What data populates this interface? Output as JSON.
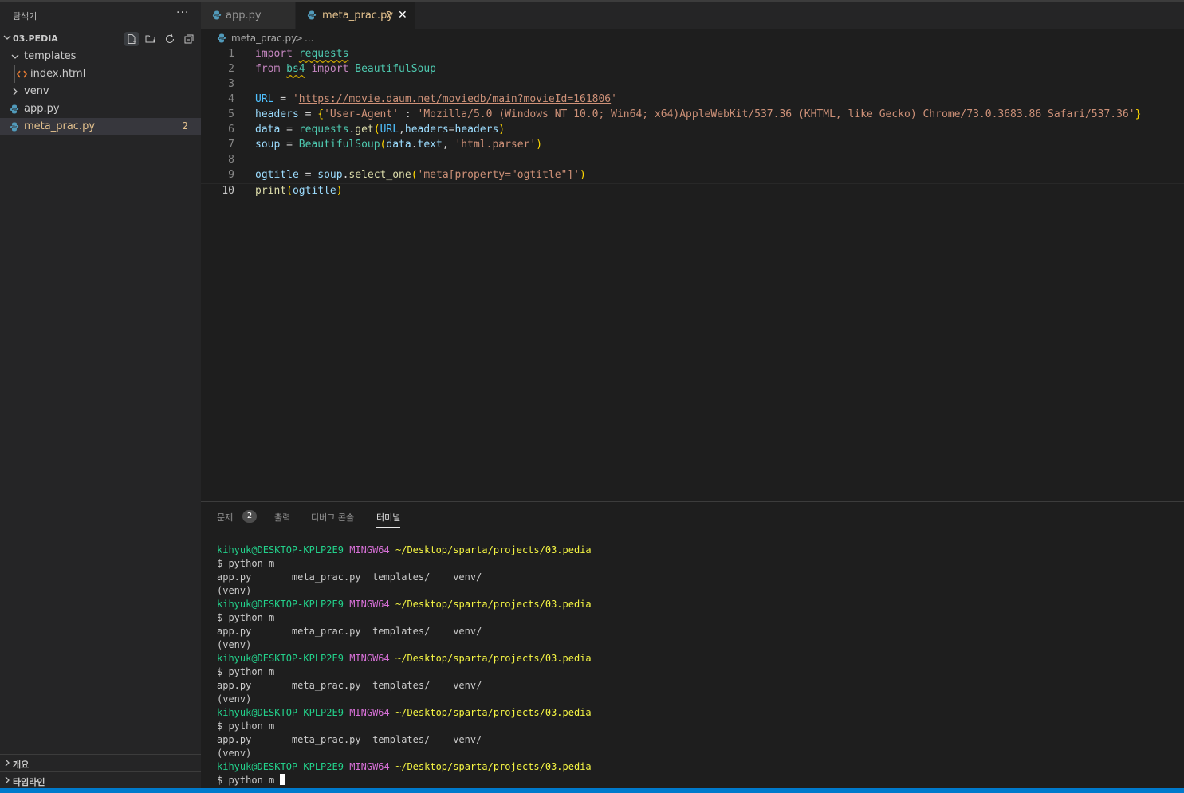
{
  "explorer": {
    "title": "탐색기",
    "more": "···",
    "folder": "03.PEDIA",
    "tree": [
      {
        "label": "templates",
        "type": "folder-open"
      },
      {
        "label": "index.html",
        "type": "html-file"
      },
      {
        "label": "venv",
        "type": "folder-closed"
      },
      {
        "label": "app.py",
        "type": "python-file"
      },
      {
        "label": "meta_prac.py",
        "type": "python-file",
        "badge": "2",
        "selected": true
      }
    ],
    "bottom_sections": [
      "개요",
      "타임라인"
    ]
  },
  "tabs": [
    {
      "label": "app.py",
      "active": false
    },
    {
      "label": "meta_prac.py",
      "count": "2",
      "active": true,
      "close": "✕"
    }
  ],
  "breadcrumb": {
    "file": "meta_prac.py",
    "sep": ">",
    "rest": "..."
  },
  "code": {
    "line_numbers": [
      "1",
      "2",
      "3",
      "4",
      "5",
      "6",
      "7",
      "8",
      "9",
      "10"
    ],
    "current_line": "10",
    "tokens": {
      "import": "import",
      "requests": "requests",
      "from": "from",
      "bs4": "bs4",
      "BeautifulSoup": "BeautifulSoup",
      "URL": "URL",
      "eq": " = ",
      "url_q": "'",
      "url_value": "https://movie.daum.net/moviedb/main?movieId=161806",
      "headers": "headers",
      "brace_open": "{",
      "brace_close": "}",
      "ua_key": "'User-Agent'",
      "colon": " : ",
      "ua_value": "'Mozilla/5.0 (Windows NT 10.0; Win64; x64)AppleWebKit/537.36 (KHTML, like Gecko) Chrome/73.0.3683.86 Safari/537.36'",
      "data": "data",
      "dot": ".",
      "get": "get",
      "paren_open": "(",
      "paren_close": ")",
      "comma": ",",
      "eq_tight": "=",
      "soup": "soup",
      "text": "text",
      "comma_space": ", ",
      "html_parser": "'html.parser'",
      "ogtitle": "ogtitle",
      "select_one": "select_one",
      "selector": "'meta[property=\"ogtitle\"]'",
      "print": "print"
    }
  },
  "panel": {
    "tabs": [
      {
        "label": "문제",
        "badge": "2"
      },
      {
        "label": "출력"
      },
      {
        "label": "디버그 콘솔"
      },
      {
        "label": "터미널",
        "active": true
      }
    ]
  },
  "terminal": {
    "user": "kihyuk@DESKTOP-KPLP2E9",
    "sys": "MINGW64",
    "path": "~/Desktop/sparta/projects/03.pedia",
    "command": "$ python m",
    "listing": "app.py       meta_prac.py  templates/    venv/",
    "venv": "(venv)"
  }
}
